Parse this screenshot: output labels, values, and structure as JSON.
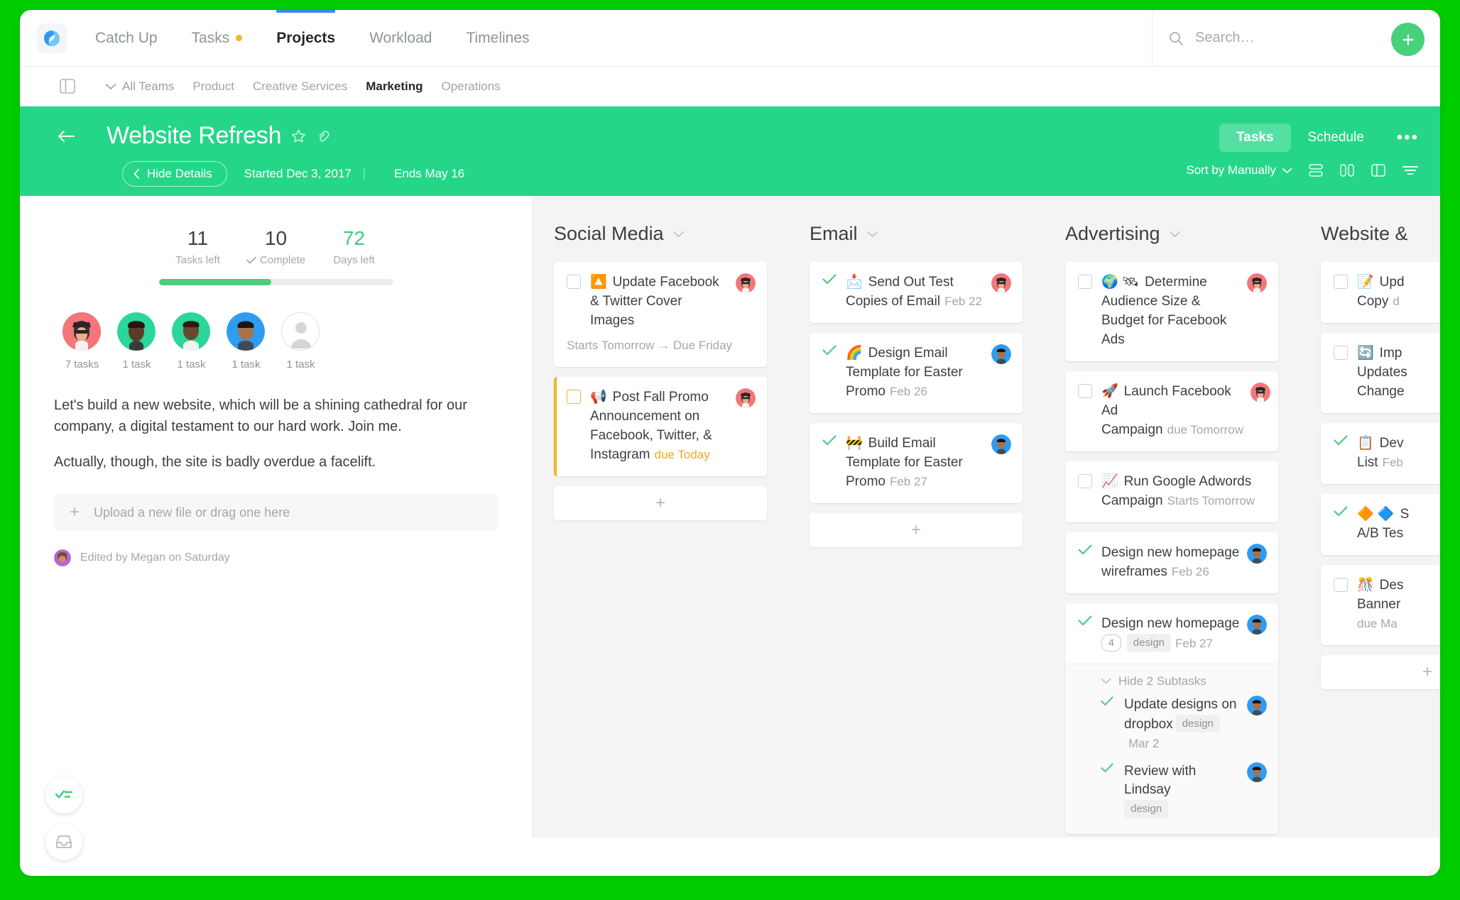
{
  "topnav": {
    "logo_icon": "app-logo-icon",
    "items": [
      {
        "label": "Catch Up",
        "active": false,
        "dot": false
      },
      {
        "label": "Tasks",
        "active": false,
        "dot": true
      },
      {
        "label": "Projects",
        "active": true,
        "dot": false
      },
      {
        "label": "Workload",
        "active": false,
        "dot": false
      },
      {
        "label": "Timelines",
        "active": false,
        "dot": false
      }
    ],
    "search_placeholder": "Search…",
    "search_value": "",
    "add_label": "+"
  },
  "teamsbar": {
    "panel_toggle_icon": "sidebar-toggle-icon",
    "all_teams": "All Teams",
    "teams": [
      {
        "label": "Product",
        "active": false
      },
      {
        "label": "Creative Services",
        "active": false
      },
      {
        "label": "Marketing",
        "active": true
      },
      {
        "label": "Operations",
        "active": false
      }
    ]
  },
  "project_header": {
    "back_icon": "back-arrow-icon",
    "title": "Website Refresh",
    "star_icon": "star-icon",
    "link_icon": "link-icon",
    "hide_details": "Hide Details",
    "started": "Started Dec 3, 2017",
    "ends": "Ends May 16",
    "tabs": [
      {
        "label": "Tasks",
        "active": true
      },
      {
        "label": "Schedule",
        "active": false
      }
    ],
    "more_label": "•••",
    "sort_by": "Sort by Manually",
    "accent_color": "#26d688"
  },
  "details": {
    "stats": [
      {
        "value": "11",
        "label": "Tasks left",
        "check": false,
        "green": false
      },
      {
        "value": "10",
        "label": "Complete",
        "check": true,
        "green": false
      },
      {
        "value": "72",
        "label": "Days left",
        "check": false,
        "green": true
      }
    ],
    "progress_percent": 48,
    "members": [
      {
        "tasks": "7 tasks",
        "bg": "#f4767b"
      },
      {
        "tasks": "1 task",
        "bg": "#2ad69a"
      },
      {
        "tasks": "1 task",
        "bg": "#2ad69a"
      },
      {
        "tasks": "1 task",
        "bg": "#2f9cf0"
      },
      {
        "tasks": "1 task",
        "bg": "#ffffff"
      }
    ],
    "description_p1": "Let's build a new website, which will be a shining cathedral for our company, a digital testament to our hard work. Join me.",
    "description_p2": "Actually, though, the site is badly overdue a facelift.",
    "upload_label": "Upload a new file or drag one here",
    "edited_label": "Edited by Megan on Saturday"
  },
  "board": {
    "add_label": "+",
    "columns": [
      {
        "title": "Social Media",
        "has_add": true,
        "cards": [
          {
            "state": "unchecked",
            "highlight": false,
            "emoji": "🔼",
            "text": "Update Facebook & Twitter Cover Images",
            "meta": "Starts Tomorrow → Due Friday",
            "meta_style": "block",
            "avatar_bg": "#f4767b"
          },
          {
            "state": "unchecked-amber",
            "highlight": true,
            "emoji": "📢",
            "text": "Post Fall Promo Announcement on Facebook, Twitter, & Instagram",
            "meta": "due Today",
            "meta_style": "inline-amber",
            "avatar_bg": "#f4767b"
          }
        ]
      },
      {
        "title": "Email",
        "has_add": true,
        "cards": [
          {
            "state": "checked",
            "highlight": false,
            "emoji": "📩",
            "text": "Send Out Test Copies of Email",
            "meta": "Feb 22",
            "meta_style": "inline",
            "avatar_bg": "#f4767b"
          },
          {
            "state": "checked",
            "highlight": false,
            "emoji": "🌈",
            "text": "Design Email Template for Easter Promo",
            "meta": "Feb 26",
            "meta_style": "inline",
            "avatar_bg": "#2f9cf0"
          },
          {
            "state": "checked",
            "highlight": false,
            "emoji": "🚧",
            "text": "Build Email Template for Easter Promo",
            "meta": "Feb 27",
            "meta_style": "inline",
            "avatar_bg": "#2f9cf0"
          }
        ]
      },
      {
        "title": "Advertising",
        "has_add": true,
        "cards": [
          {
            "state": "unchecked",
            "highlight": false,
            "emoji": "🌍 🛰",
            "text": "Determine Audience Size & Budget for Facebook Ads",
            "meta": "",
            "meta_style": "inline",
            "avatar_bg": "#f4767b"
          },
          {
            "state": "unchecked",
            "highlight": false,
            "emoji": "🚀",
            "text": "Launch Facebook Ad Campaign",
            "meta": "due Tomorrow",
            "meta_style": "inline",
            "avatar_bg": "#f4767b"
          },
          {
            "state": "unchecked",
            "highlight": false,
            "emoji": "📈",
            "text": "Run Google Adwords Campaign",
            "meta": "Starts Tomorrow",
            "meta_style": "inline",
            "avatar_bg": null
          },
          {
            "state": "checked",
            "highlight": false,
            "emoji": "",
            "text": "Design new homepage wireframes",
            "meta": "Feb 26",
            "meta_style": "inline",
            "avatar_bg": "#2f9cf0"
          },
          {
            "state": "checked",
            "highlight": false,
            "emoji": "",
            "text": "Design new homepage",
            "meta": "Feb 27",
            "meta_style": "badge-row",
            "comment_count": "4",
            "tag": "design",
            "avatar_bg": "#2f9cf0",
            "subtasks_toggle": "Hide 2 Subtasks",
            "subtasks": [
              {
                "state": "checked",
                "text": "Update designs on dropbox",
                "tag": "design",
                "meta": "Mar 2",
                "avatar_bg": "#2f9cf0"
              },
              {
                "state": "checked",
                "text": "Review with Lindsay",
                "tag": "design",
                "meta": "",
                "avatar_bg": "#2f9cf0"
              }
            ]
          }
        ]
      },
      {
        "title": "Website &",
        "has_add": true,
        "clipped": true,
        "cards": [
          {
            "state": "unchecked",
            "emoji": "📝",
            "text": "Upd",
            "text2": "Copy",
            "meta": "d"
          },
          {
            "state": "unchecked",
            "emoji": "🔄",
            "text": "Imp",
            "text2": "Updates",
            "text3": "Change"
          },
          {
            "state": "checked",
            "emoji": "📋",
            "text": "Dev",
            "text2": "List",
            "meta": "Feb"
          },
          {
            "state": "checked",
            "emoji": "🔶 🔷",
            "text": "S",
            "text2": "A/B Tes"
          },
          {
            "state": "unchecked",
            "emoji": "🎊",
            "text": "Des",
            "text2": "Banner",
            "meta": "due Ma"
          }
        ]
      }
    ]
  },
  "fabs": [
    {
      "icon": "checklist-icon"
    },
    {
      "icon": "inbox-icon"
    }
  ]
}
